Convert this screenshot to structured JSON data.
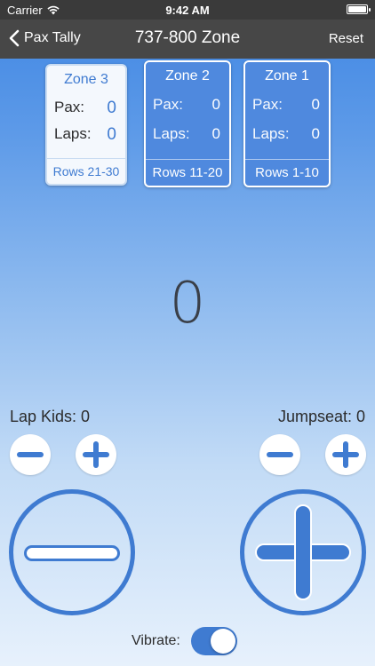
{
  "status_bar": {
    "carrier": "Carrier",
    "time": "9:42 AM",
    "wifi_icon": "wifi-icon",
    "battery_icon": "battery-icon"
  },
  "nav": {
    "back_label": "Pax Tally",
    "title": "737-800 Zone",
    "reset_label": "Reset"
  },
  "zones": [
    {
      "title": "Zone 3",
      "pax_label": "Pax:",
      "pax": "0",
      "laps_label": "Laps:",
      "laps": "0",
      "rows": "Rows 21-30",
      "selected": true
    },
    {
      "title": "Zone 2",
      "pax_label": "Pax:",
      "pax": "0",
      "laps_label": "Laps:",
      "laps": "0",
      "rows": "Rows 11-20",
      "selected": false
    },
    {
      "title": "Zone 1",
      "pax_label": "Pax:",
      "pax": "0",
      "laps_label": "Laps:",
      "laps": "0",
      "rows": "Rows 1-10",
      "selected": false
    }
  ],
  "main_count": "0",
  "lap_kids": {
    "label": "Lap Kids: 0"
  },
  "jumpseat": {
    "label": "Jumpseat: 0"
  },
  "vibrate": {
    "label": "Vibrate:",
    "on": true
  },
  "colors": {
    "accent": "#3f7bd1",
    "navbar": "#474747",
    "statusbar": "#3a3a3a"
  }
}
